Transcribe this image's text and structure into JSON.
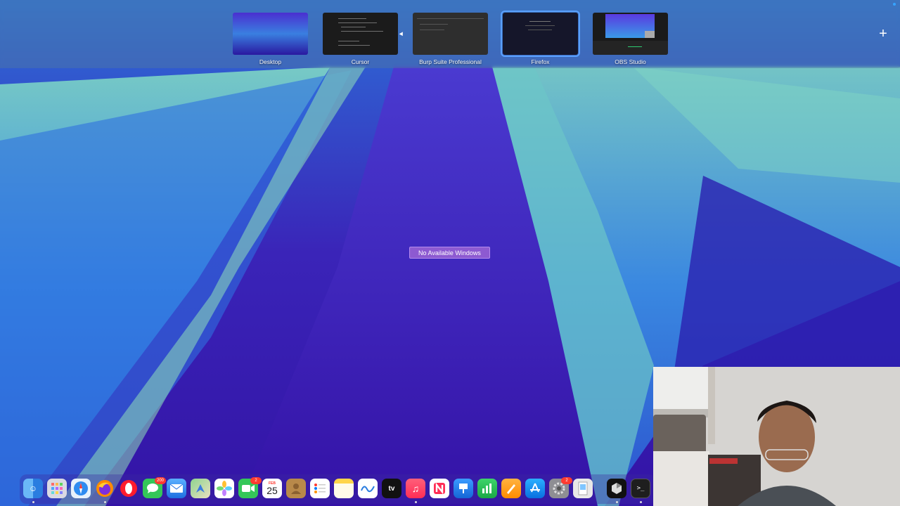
{
  "spaces": [
    {
      "label": "Desktop"
    },
    {
      "label": "Cursor"
    },
    {
      "label": "Burp Suite Professional"
    },
    {
      "label": "Firefox"
    },
    {
      "label": "OBS Studio"
    }
  ],
  "add_space_icon": "plus-icon",
  "no_windows_label": "No Available Windows",
  "dock": {
    "apps": [
      {
        "name": "finder",
        "icon": "finder-icon"
      },
      {
        "name": "launchpad",
        "icon": "launchpad-icon"
      },
      {
        "name": "safari",
        "icon": "safari-icon"
      },
      {
        "name": "firefox",
        "icon": "firefox-icon"
      },
      {
        "name": "opera",
        "icon": "opera-icon"
      },
      {
        "name": "messages",
        "icon": "messages-icon",
        "badge": "200"
      },
      {
        "name": "mail",
        "icon": "mail-icon"
      },
      {
        "name": "maps",
        "icon": "maps-icon"
      },
      {
        "name": "photos",
        "icon": "photos-icon"
      },
      {
        "name": "facetime",
        "icon": "facetime-icon",
        "badge": "2"
      },
      {
        "name": "calendar",
        "icon": "calendar-icon",
        "month": "FEB",
        "day": "25"
      },
      {
        "name": "contacts",
        "icon": "contacts-icon"
      },
      {
        "name": "reminders",
        "icon": "reminders-icon"
      },
      {
        "name": "notes",
        "icon": "notes-icon"
      },
      {
        "name": "freeform",
        "icon": "freeform-icon"
      },
      {
        "name": "apple-tv",
        "icon": "tv-icon",
        "text": "tv"
      },
      {
        "name": "music",
        "icon": "music-icon"
      },
      {
        "name": "news",
        "icon": "news-icon"
      },
      {
        "name": "keynote",
        "icon": "keynote-icon"
      },
      {
        "name": "numbers",
        "icon": "numbers-icon"
      },
      {
        "name": "pages",
        "icon": "pages-icon"
      },
      {
        "name": "app-store",
        "icon": "app-store-icon"
      },
      {
        "name": "system-settings",
        "icon": "settings-icon",
        "badge": "2"
      },
      {
        "name": "preview",
        "icon": "preview-icon"
      },
      {
        "name": "cursor",
        "icon": "cursor-app-icon"
      },
      {
        "name": "terminal",
        "icon": "terminal-icon"
      }
    ]
  },
  "colors": {
    "wallpaper_base": "#3a1fb0",
    "wallpaper_wave": "#3b8ae6",
    "wallpaper_highlight": "#6fd0c0",
    "no_windows_bg": "#8d5ad1",
    "active_space_outline": "#5aa0ff"
  }
}
